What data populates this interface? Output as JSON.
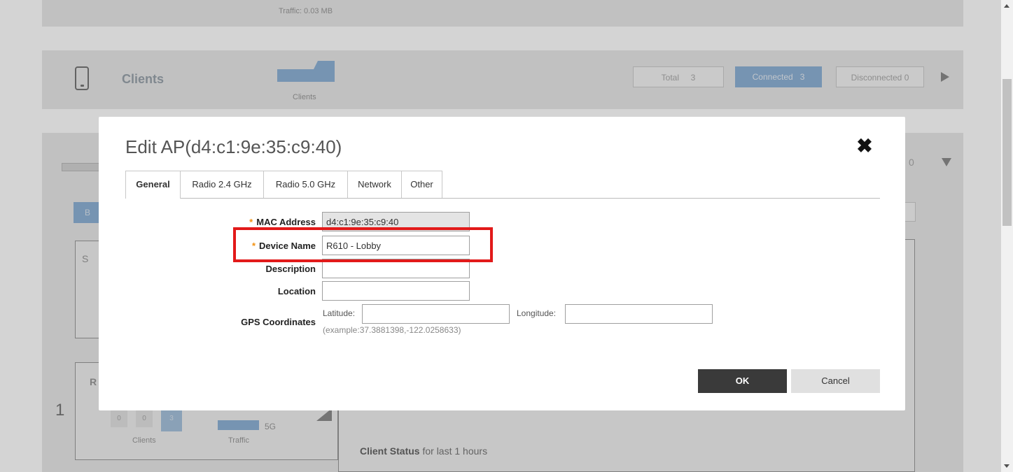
{
  "background": {
    "traffic_text": "Traffic: 0.03 MB",
    "clients_title": "Clients",
    "clients_chart_label": "Clients",
    "stats": {
      "total_label": "Total",
      "total_value": "3",
      "connected_label": "Connected",
      "connected_value": "3",
      "disconnected_label": "Disconnected",
      "disconnected_value": "0"
    },
    "row_number": "1",
    "client_counts": [
      "0",
      "0",
      "3"
    ],
    "clients_caption": "Clients",
    "traffic_caption": "Traffic",
    "band_label": "5G",
    "partial_b": "B",
    "partial_s": "S",
    "partial_r": "R",
    "partial_zero": "0",
    "client_status_bold": "Client Status",
    "client_status_rest": " for last 1 hours"
  },
  "dialog": {
    "title": "Edit AP(d4:c1:9e:35:c9:40)",
    "tabs": [
      {
        "label": "General",
        "active": true
      },
      {
        "label": "Radio 2.4 GHz",
        "active": false
      },
      {
        "label": "Radio 5.0 GHz",
        "active": false
      },
      {
        "label": "Network",
        "active": false
      },
      {
        "label": "Other",
        "active": false
      }
    ],
    "fields": {
      "mac_label": "MAC Address",
      "mac_value": "d4:c1:9e:35:c9:40",
      "device_name_label": "Device Name",
      "device_name_value": "R610 - Lobby",
      "description_label": "Description",
      "description_value": "",
      "location_label": "Location",
      "location_value": "",
      "gps_label": "GPS Coordinates",
      "latitude_label": "Latitude:",
      "latitude_value": "",
      "longitude_label": "Longitude:",
      "longitude_value": "",
      "gps_example": "(example:37.3881398,-122.0258633)"
    },
    "required_marker": "*",
    "ok_label": "OK",
    "cancel_label": "Cancel",
    "close_icon": "close-icon"
  },
  "colors": {
    "highlight": "#e21a1a",
    "required": "#f29111",
    "ok_button": "#3a3a3a",
    "connected_badge": "#8fb2d6"
  }
}
